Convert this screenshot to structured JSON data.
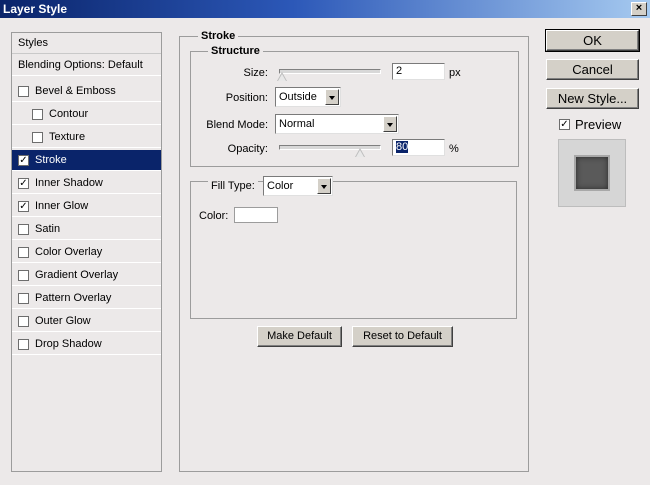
{
  "window": {
    "title": "Layer Style",
    "close_glyph": "×"
  },
  "sidebar": {
    "header": "Styles",
    "blending": "Blending Options: Default",
    "items": [
      {
        "label": "Bevel & Emboss",
        "checked": false,
        "indent": false
      },
      {
        "label": "Contour",
        "checked": false,
        "indent": true
      },
      {
        "label": "Texture",
        "checked": false,
        "indent": true
      },
      {
        "label": "Stroke",
        "checked": true,
        "indent": false,
        "selected": true
      },
      {
        "label": "Inner Shadow",
        "checked": true,
        "indent": false
      },
      {
        "label": "Inner Glow",
        "checked": true,
        "indent": false
      },
      {
        "label": "Satin",
        "checked": false,
        "indent": false
      },
      {
        "label": "Color Overlay",
        "checked": false,
        "indent": false
      },
      {
        "label": "Gradient Overlay",
        "checked": false,
        "indent": false
      },
      {
        "label": "Pattern Overlay",
        "checked": false,
        "indent": false
      },
      {
        "label": "Outer Glow",
        "checked": false,
        "indent": false
      },
      {
        "label": "Drop Shadow",
        "checked": false,
        "indent": false
      }
    ]
  },
  "stroke": {
    "title": "Stroke",
    "structure_title": "Structure",
    "size_label": "Size:",
    "size_value": "2",
    "size_unit": "px",
    "position_label": "Position:",
    "position_value": "Outside",
    "blend_label": "Blend Mode:",
    "blend_value": "Normal",
    "opacity_label": "Opacity:",
    "opacity_value": "80",
    "opacity_unit": "%",
    "fill_type_label": "Fill Type:",
    "fill_type_value": "Color",
    "color_label": "Color:",
    "make_default": "Make Default",
    "reset_default": "Reset to Default"
  },
  "actions": {
    "ok": "OK",
    "cancel": "Cancel",
    "new_style": "New Style...",
    "preview_label": "Preview",
    "preview_checked": true
  },
  "colors": {
    "selected_bg": "#0a246a",
    "dialog_bg": "#ece9e9"
  }
}
